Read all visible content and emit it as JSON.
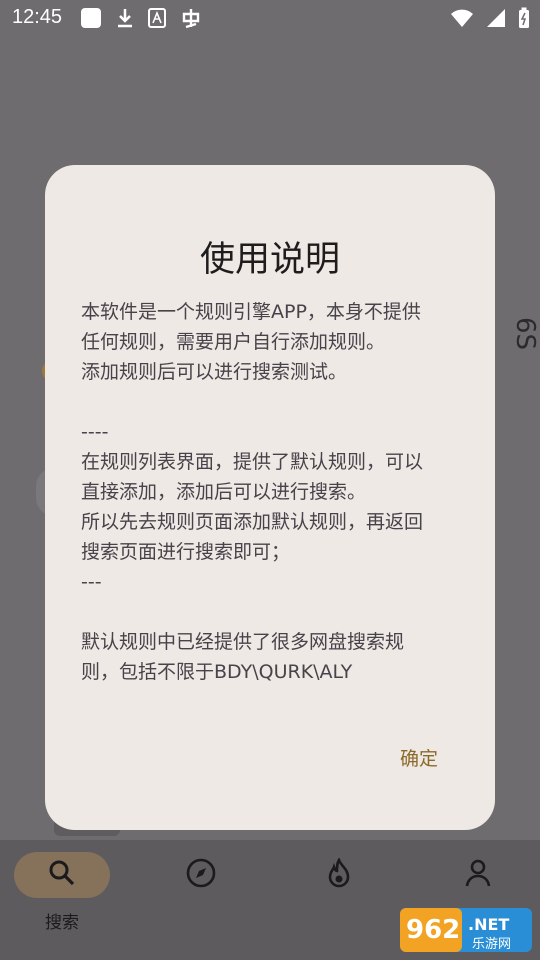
{
  "status_bar": {
    "time": "12:45"
  },
  "background_page": {
    "side_text": "6S"
  },
  "bottom_nav": {
    "items": [
      {
        "label": "搜索",
        "icon": "search-icon",
        "active": true
      },
      {
        "label": "",
        "icon": "compass-icon",
        "active": false
      },
      {
        "label": "",
        "icon": "flame-icon",
        "active": false
      },
      {
        "label": "",
        "icon": "person-icon",
        "active": false
      }
    ]
  },
  "dialog": {
    "title": "使用说明",
    "body": "本软件是一个规则引擎APP，本身不提供\n任何规则，需要用户自行添加规则。\n添加规则后可以进行搜索测试。\n\n----\n在规则列表界面，提供了默认规则，可以\n直接添加，添加后可以进行搜索。\n所以先去规则页面添加默认规则，再返回\n搜索页面进行搜索即可；\n---\n\n默认规则中已经提供了很多网盘搜索规\n则，包括不限于BDY\\QURK\\ALY",
    "confirm_label": "确定"
  },
  "watermark": {
    "brand": "962",
    "suffix": ".NET",
    "caption": "乐游网"
  },
  "colors": {
    "scrim": "#6f6c70",
    "dialog_bg": "#efe9e5",
    "accent": "#8a6a2a"
  }
}
